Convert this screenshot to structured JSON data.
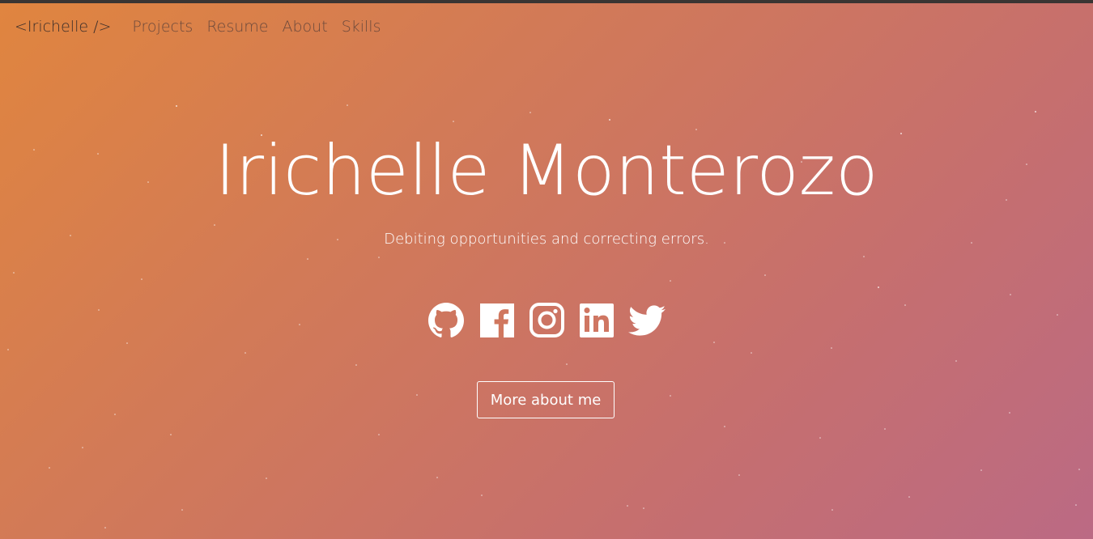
{
  "nav": {
    "brand": "<Irichelle />",
    "links": [
      "Projects",
      "Resume",
      "About",
      "Skills"
    ]
  },
  "hero": {
    "name": "Irichelle Monterozo",
    "tagline": "Debiting opportunities and correcting errors.",
    "button_label": "More about me"
  },
  "socials": [
    {
      "icon": "github-icon"
    },
    {
      "icon": "facebook-icon"
    },
    {
      "icon": "instagram-icon"
    },
    {
      "icon": "linkedin-icon"
    },
    {
      "icon": "twitter-icon"
    }
  ],
  "colors": {
    "gradient_start": "#e0853f",
    "gradient_end": "#bb6a84",
    "text_light": "#ffffff",
    "nav_text": "#6d4a3c"
  }
}
